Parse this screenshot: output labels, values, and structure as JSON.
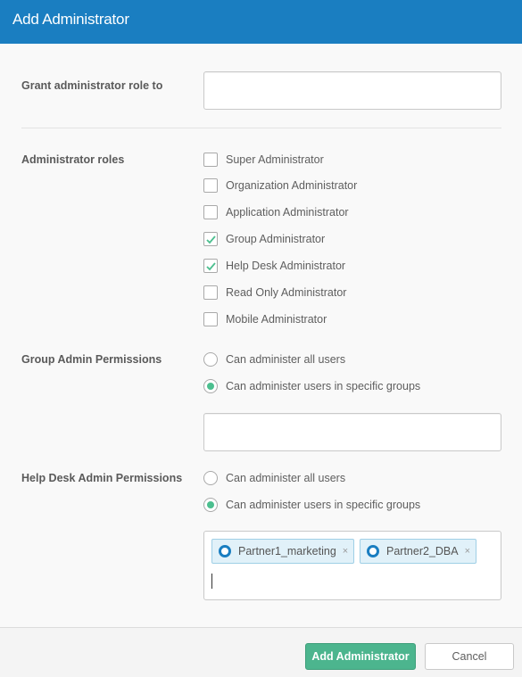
{
  "dialog": {
    "title": "Add Administrator"
  },
  "grant": {
    "label": "Grant administrator role to",
    "value": ""
  },
  "roles": {
    "label": "Administrator roles",
    "items": [
      {
        "label": "Super Administrator",
        "checked": false
      },
      {
        "label": "Organization Administrator",
        "checked": false
      },
      {
        "label": "Application Administrator",
        "checked": false
      },
      {
        "label": "Group Administrator",
        "checked": true
      },
      {
        "label": "Help Desk Administrator",
        "checked": true
      },
      {
        "label": "Read Only Administrator",
        "checked": false
      },
      {
        "label": "Mobile Administrator",
        "checked": false
      }
    ]
  },
  "group_perms": {
    "label": "Group Admin Permissions",
    "options": [
      {
        "label": "Can administer all users",
        "selected": false
      },
      {
        "label": "Can administer users in specific groups",
        "selected": true
      }
    ],
    "groups_value": ""
  },
  "helpdesk_perms": {
    "label": "Help Desk Admin Permissions",
    "options": [
      {
        "label": "Can administer all users",
        "selected": false
      },
      {
        "label": "Can administer users in specific groups",
        "selected": true
      }
    ],
    "groups": [
      {
        "name": "Partner1_marketing",
        "remove": "×"
      },
      {
        "name": "Partner2_DBA",
        "remove": "×"
      }
    ]
  },
  "footer": {
    "submit_label": "Add Administrator",
    "cancel_label": "Cancel"
  },
  "colors": {
    "header": "#1a7ec1",
    "accent_green": "#4cb58e",
    "chip_bg": "#e1f1f9"
  }
}
